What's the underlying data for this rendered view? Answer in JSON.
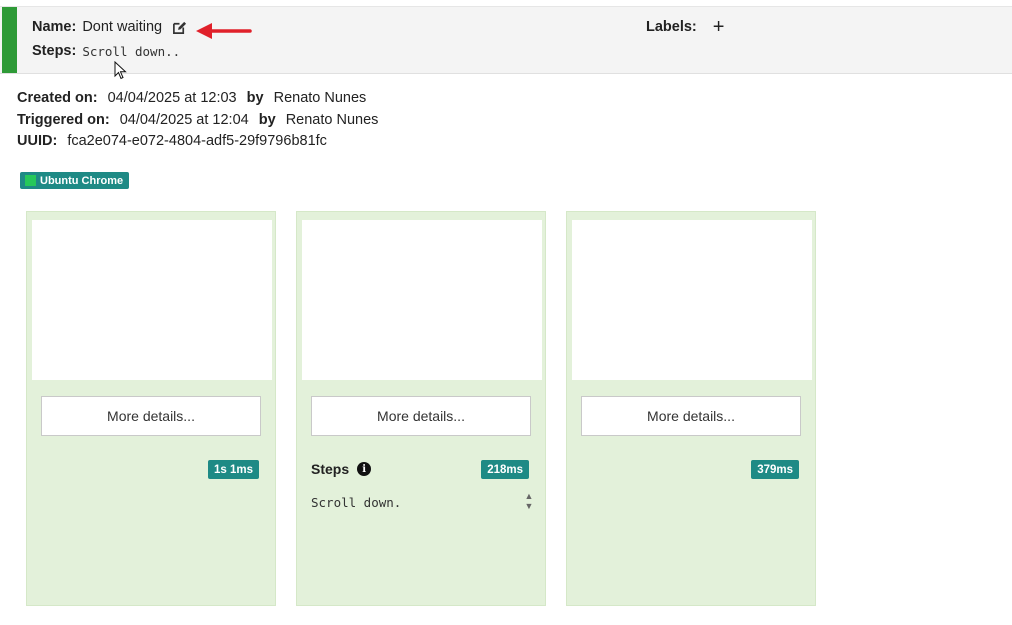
{
  "header": {
    "name_label": "Name:",
    "name_value": "Dont waiting",
    "steps_label": "Steps:",
    "steps_value": "Scroll down..",
    "labels_label": "Labels:",
    "add_label_glyph": "+"
  },
  "meta": {
    "created_label": "Created on:",
    "created_date": "04/04/2025 at 12:03",
    "by_label": "by",
    "created_by": "Renato Nunes",
    "triggered_label": "Triggered on:",
    "triggered_date": "04/04/2025 at 12:04",
    "triggered_by": "Renato Nunes",
    "uuid_label": "UUID:",
    "uuid_value": "fca2e074-e072-4804-adf5-29f9796b81fc"
  },
  "environment": {
    "badge_label": "Ubuntu Chrome",
    "dot_color": "#26c85a",
    "badge_color": "#1e8a85"
  },
  "cards": [
    {
      "more_label": "More details...",
      "duration": "1s 1ms"
    },
    {
      "more_label": "More details...",
      "duration": "218ms",
      "steps_title": "Steps",
      "steps_text": "Scroll down."
    },
    {
      "more_label": "More details...",
      "duration": "379ms"
    }
  ],
  "colors": {
    "accent_bar": "#2e9a37",
    "card_bg": "#e3f1da",
    "annotation_arrow": "#e0202a"
  },
  "icons": {
    "edit": "edit-icon",
    "arrow": "red-arrow-annotation-icon",
    "cursor": "mouse-cursor-icon",
    "info": "info-icon",
    "spinner": "spinner-arrows-icon"
  }
}
